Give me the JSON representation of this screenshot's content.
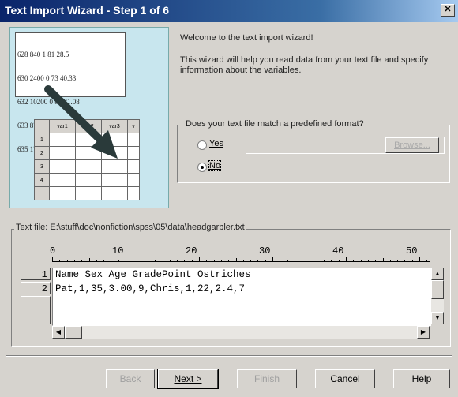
{
  "window": {
    "title": "Text Import Wizard - Step 1 of 6",
    "close_label": "✕"
  },
  "illustration": {
    "data_lines": [
      "628 840 1 81 28.5",
      "630 2400 0 73 40.33",
      "632 10200 0 83 31.08",
      "633 870 0 93 31.17",
      "635 1740 0 83 41.91"
    ],
    "grid_headers": [
      "var1",
      "var2",
      "var3",
      "v"
    ],
    "row_numbers": [
      "1",
      "2",
      "3",
      "4"
    ]
  },
  "intro": {
    "welcome": "Welcome to the text import wizard!",
    "description": "This wizard will help you read data from your text file and specify information about the variables."
  },
  "format_question": {
    "label": "Does your text file match a predefined format?",
    "yes_label": "Yes",
    "no_label": "No",
    "selected": "No",
    "browse_label": "Browse..."
  },
  "file_preview": {
    "label": "Text file: E:\\stuff\\doc\\nonfiction\\spss\\05\\data\\headgarbler.txt",
    "ruler": [
      "0",
      "10",
      "20",
      "30",
      "40",
      "50"
    ],
    "lines": [
      {
        "num": "1",
        "text": "Name Sex Age GradePoint Ostriches"
      },
      {
        "num": "2",
        "text": "Pat,1,35,3.00,9,Chris,1,22,2.4,7"
      }
    ]
  },
  "buttons": {
    "back": "Back",
    "next": "Next >",
    "finish": "Finish",
    "cancel": "Cancel",
    "help": "Help"
  }
}
